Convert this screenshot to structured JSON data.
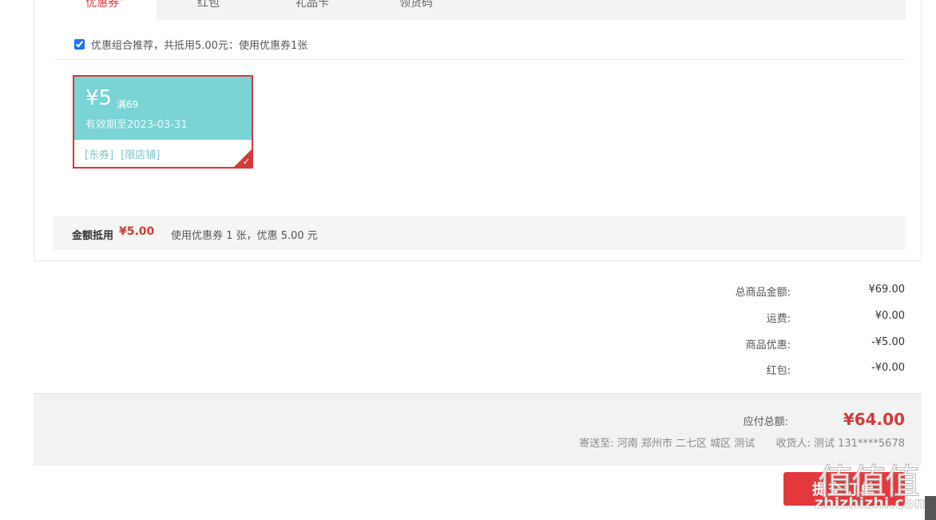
{
  "tabs": [
    {
      "label": "优惠券",
      "active": true
    },
    {
      "label": "红包",
      "active": false
    },
    {
      "label": "礼品卡",
      "active": false
    },
    {
      "label": "领货码",
      "active": false
    }
  ],
  "recommend": {
    "checked": true,
    "text": "优惠组合推荐，共抵用5.00元：使用优惠券1张"
  },
  "coupon": {
    "amount": "¥5",
    "condition": "满69",
    "valid": "有效期至2023-03-31",
    "tags": [
      "[东券]",
      "[限店铺]"
    ],
    "selected": true,
    "color": "#7ad3d5"
  },
  "summary": {
    "label": "金额抵用",
    "amount": "¥5.00",
    "desc": "使用优惠券 1 张，优惠 5.00 元"
  },
  "totals": [
    {
      "label": "总商品金额:",
      "value": "¥69.00"
    },
    {
      "label": "运费:",
      "value": "¥0.00"
    },
    {
      "label": "商品优惠:",
      "value": "-¥5.00"
    },
    {
      "label": "红包:",
      "value": "-¥0.00"
    }
  ],
  "payable": {
    "label": "应付总额:",
    "amount": "¥64.00",
    "ship_to_label": "寄送至:",
    "ship_to": "河南 郑州市 二七区 城区 测试",
    "receiver_label": "收货人:",
    "receiver": "测试 131****5678"
  },
  "submit_label": "提交订单",
  "watermark": {
    "logo": "值值值",
    "site": "zhizhizhi.com"
  },
  "colors": {
    "accent": "#e4393c",
    "coupon": "#7ad3d5"
  }
}
